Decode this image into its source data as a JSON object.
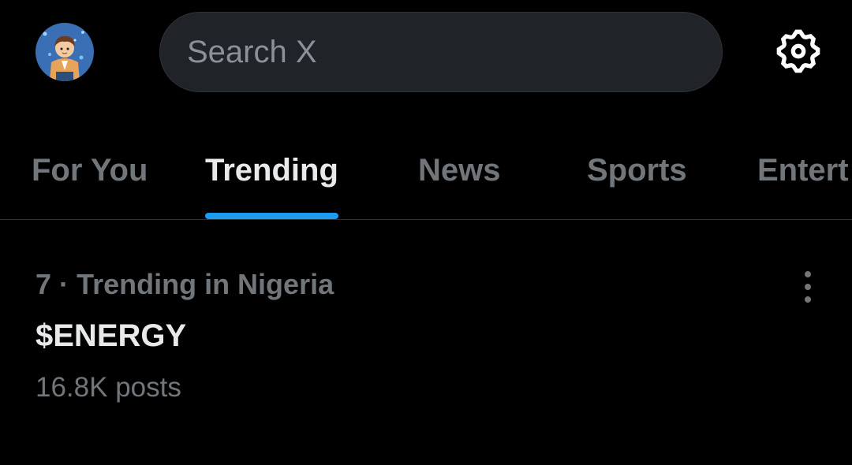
{
  "header": {
    "avatar_icon": "user-avatar-icon",
    "search": {
      "placeholder": "Search X",
      "value": ""
    },
    "settings_icon": "gear-icon"
  },
  "tabs": [
    {
      "label": "For You",
      "active": false
    },
    {
      "label": "Trending",
      "active": true
    },
    {
      "label": "News",
      "active": false
    },
    {
      "label": "Sports",
      "active": false
    },
    {
      "label": "Entert",
      "active": false
    }
  ],
  "trends": [
    {
      "rank": "7",
      "separator": "·",
      "context": "Trending in Nigeria",
      "name": "$ENERGY",
      "posts": "16.8K posts",
      "more_icon": "more-vertical-icon"
    }
  ],
  "colors": {
    "background": "#000000",
    "text_primary": "#e7e9ea",
    "text_secondary": "#71767b",
    "accent": "#1d9bf0",
    "search_bg": "#202327",
    "divider": "#2f3336"
  }
}
